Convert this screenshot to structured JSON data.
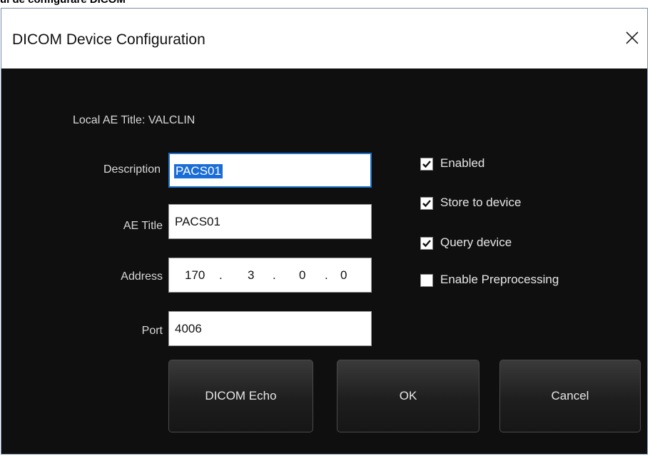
{
  "page_caption": "ul de configurare DICOM",
  "window": {
    "title": "DICOM Device Configuration",
    "close_glyph": "X"
  },
  "local_ae": "Local AE Title: VALCLIN",
  "fields": {
    "description": {
      "label": "Description",
      "value": "PACS01"
    },
    "ae_title": {
      "label": "AE Title",
      "value": "PACS01"
    },
    "address": {
      "label": "Address",
      "octets": [
        "170",
        "3",
        "0",
        "0"
      ],
      "dot": "."
    },
    "port": {
      "label": "Port",
      "value": "4006"
    }
  },
  "checkboxes": [
    {
      "label": "Enabled",
      "checked": true
    },
    {
      "label": "Store to device",
      "checked": true
    },
    {
      "label": "Query device",
      "checked": true
    },
    {
      "label": "Enable Preprocessing",
      "checked": false
    }
  ],
  "buttons": {
    "echo": "DICOM Echo",
    "ok": "OK",
    "cancel": "Cancel"
  },
  "colors": {
    "dialog_bg": "#0f0f0f",
    "focus_border": "#1e73c8",
    "selection": "#1a6dd6"
  },
  "icons": {
    "close": "close-icon",
    "check": "checkmark-icon"
  }
}
